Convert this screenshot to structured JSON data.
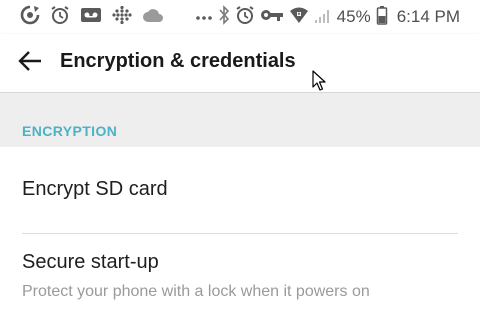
{
  "status_bar": {
    "left_icons": [
      "sync-icon",
      "alarm-icon",
      "voicemail-icon",
      "dots-grid-icon",
      "cloud-icon",
      "more-dots-icon"
    ],
    "right_icons": [
      "bluetooth-icon",
      "alarm-icon",
      "key-icon",
      "wifi-icon",
      "signal-icon",
      "battery-icon"
    ],
    "battery": "45%",
    "time": "6:14 PM"
  },
  "toolbar": {
    "back_icon": "arrow-left-icon",
    "title": "Encryption & credentials"
  },
  "section": {
    "header": "ENCRYPTION",
    "header_color": "#4bb3c5"
  },
  "items": [
    {
      "title": "Encrypt SD card"
    },
    {
      "title": "Secure start-up",
      "subtitle": "Protect your phone with a lock when it powers on"
    }
  ]
}
